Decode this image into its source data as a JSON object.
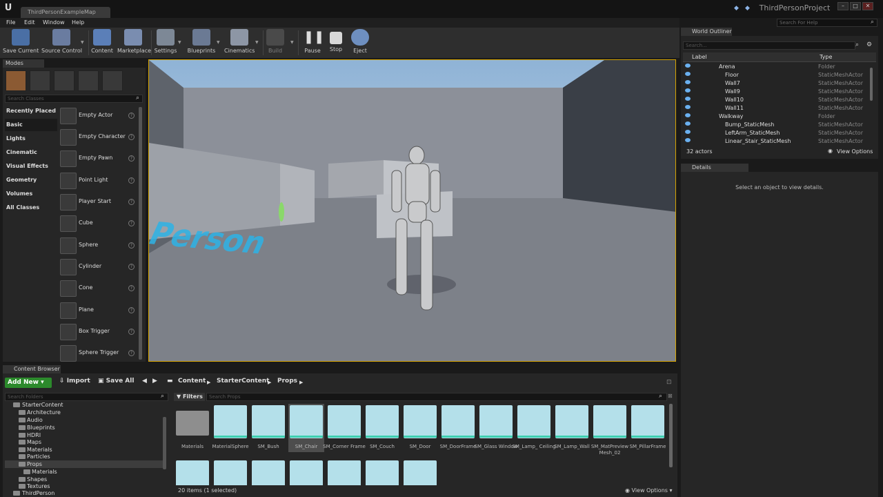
{
  "title_bar": {
    "document_tab": "ThirdPersonExampleMap",
    "project_name": "ThirdPersonProject"
  },
  "menu": {
    "items": [
      "File",
      "Edit",
      "Window",
      "Help"
    ],
    "help_search_placeholder": "Search For Help"
  },
  "toolbar": {
    "buttons": [
      "Save Current",
      "Source Control",
      "Content",
      "Marketplace",
      "Settings",
      "Blueprints",
      "Cinematics",
      "Build",
      "Pause",
      "Stop",
      "Eject"
    ]
  },
  "modes": {
    "tab_label": "Modes",
    "search_placeholder": "Search Classes",
    "categories": [
      "Recently Placed",
      "Basic",
      "Lights",
      "Cinematic",
      "Visual Effects",
      "Geometry",
      "Volumes",
      "All Classes"
    ],
    "selected_category": "Basic",
    "classes": [
      "Empty Actor",
      "Empty Character",
      "Empty Pawn",
      "Point Light",
      "Player Start",
      "Cube",
      "Sphere",
      "Cylinder",
      "Cone",
      "Plane",
      "Box Trigger",
      "Sphere Trigger"
    ]
  },
  "viewport": {
    "floor_text": "ird Person"
  },
  "world_outliner": {
    "tab_label": "World Outliner",
    "search_placeholder": "Search...",
    "columns": {
      "label": "Label",
      "type": "Type"
    },
    "rows": [
      {
        "label": "Arena",
        "type": "Folder",
        "kind": "folder",
        "depth": 1
      },
      {
        "label": "Floor",
        "type": "StaticMeshActor",
        "kind": "actor",
        "depth": 2
      },
      {
        "label": "Wall7",
        "type": "StaticMeshActor",
        "kind": "actor",
        "depth": 2
      },
      {
        "label": "Wall9",
        "type": "StaticMeshActor",
        "kind": "actor",
        "depth": 2
      },
      {
        "label": "Wall10",
        "type": "StaticMeshActor",
        "kind": "actor",
        "depth": 2
      },
      {
        "label": "Wall11",
        "type": "StaticMeshActor",
        "kind": "actor",
        "depth": 2
      },
      {
        "label": "Walkway",
        "type": "Folder",
        "kind": "folder",
        "depth": 1
      },
      {
        "label": "Bump_StaticMesh",
        "type": "StaticMeshActor",
        "kind": "actor",
        "depth": 2
      },
      {
        "label": "LeftArm_StaticMesh",
        "type": "StaticMeshActor",
        "kind": "actor",
        "depth": 2
      },
      {
        "label": "Linear_Stair_StaticMesh",
        "type": "StaticMeshActor",
        "kind": "actor",
        "depth": 2
      }
    ],
    "actor_count": "32 actors",
    "view_options": "View Options"
  },
  "details": {
    "tab_label": "Details",
    "empty_message": "Select an object to view details."
  },
  "content_browser": {
    "tab_label": "Content Browser",
    "add_new": "Add New",
    "import": "Import",
    "save_all": "Save All",
    "breadcrumbs": [
      "Content",
      "StarterContent",
      "Props"
    ],
    "folder_search_placeholder": "Search Folders",
    "folders": [
      {
        "name": "StarterContent",
        "depth": 1
      },
      {
        "name": "Architecture",
        "depth": 2
      },
      {
        "name": "Audio",
        "depth": 2
      },
      {
        "name": "Blueprints",
        "depth": 2
      },
      {
        "name": "HDRI",
        "depth": 2
      },
      {
        "name": "Maps",
        "depth": 2
      },
      {
        "name": "Materials",
        "depth": 2
      },
      {
        "name": "Particles",
        "depth": 2
      },
      {
        "name": "Props",
        "depth": 2
      },
      {
        "name": "Materials",
        "depth": 3
      },
      {
        "name": "Shapes",
        "depth": 2
      },
      {
        "name": "Textures",
        "depth": 2
      },
      {
        "name": "ThirdPerson",
        "depth": 1
      }
    ],
    "selected_folder": "Props",
    "filters_label": "Filters",
    "asset_search_placeholder": "Search Props",
    "assets": [
      "Materials",
      "MaterialSphere",
      "SM_Bush",
      "SM_Chair",
      "SM_Corner Frame",
      "SM_Couch",
      "SM_Door",
      "SM_DoorFrame",
      "SM_Glass Window",
      "SM_Lamp_ Ceiling",
      "SM_Lamp_Wall",
      "SM_MatPreview Mesh_02",
      "SM_PillarFrame"
    ],
    "selected_asset": "SM_Chair",
    "status": "20 items (1 selected)",
    "view_options": "View Options"
  }
}
